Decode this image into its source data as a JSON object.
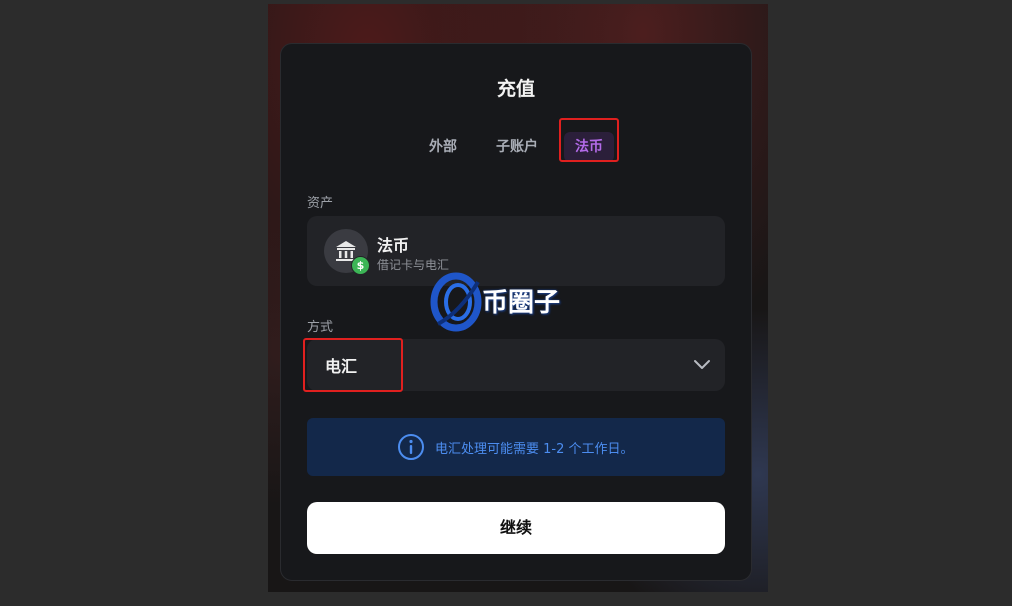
{
  "dialog": {
    "title": "充值",
    "tabs": [
      {
        "label": "外部",
        "active": false
      },
      {
        "label": "子账户",
        "active": false
      },
      {
        "label": "法币",
        "active": true
      }
    ]
  },
  "asset": {
    "label": "资产",
    "name": "法币",
    "subtitle": "借记卡与电汇",
    "icon": "bank-icon",
    "badge": "$"
  },
  "method": {
    "label": "方式",
    "value": "电汇",
    "icon": "chevron-down-icon"
  },
  "notice": {
    "icon": "info-icon",
    "text": "电汇处理可能需要 1-2 个工作日。"
  },
  "continue_label": "继续",
  "watermark": "币圈子",
  "colors": {
    "accent": "#b36be8",
    "highlight": "#e0201f",
    "notice_text": "#4c8df0",
    "badge": "#3cb556"
  }
}
